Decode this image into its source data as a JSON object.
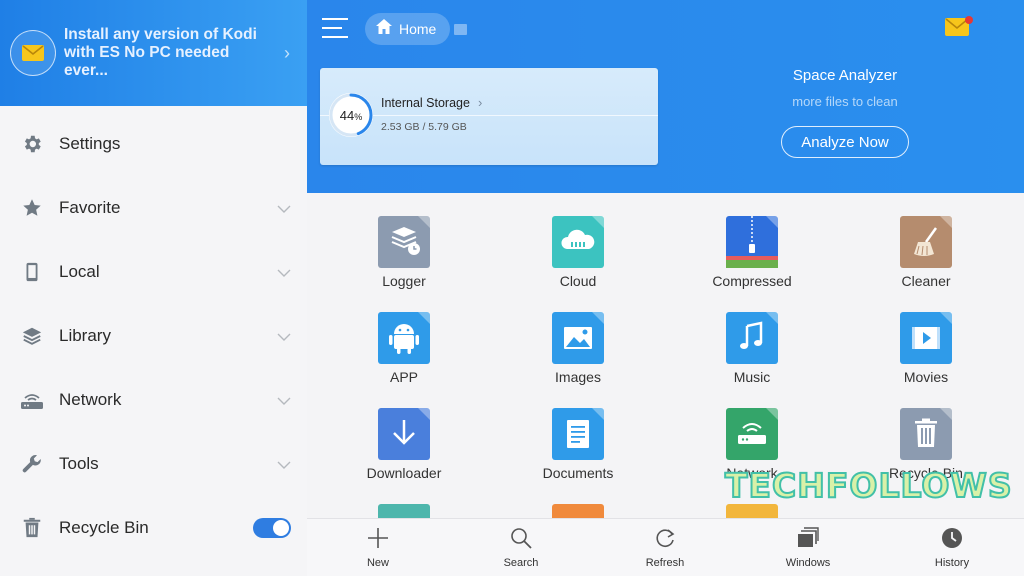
{
  "promo": {
    "text": "Install any version of Kodi with ES No PC needed ever...",
    "icon": "mail-icon"
  },
  "sidebar": {
    "items": [
      {
        "label": "Settings",
        "icon": "gear-icon",
        "expandable": false
      },
      {
        "label": "Favorite",
        "icon": "star-icon",
        "expandable": true
      },
      {
        "label": "Local",
        "icon": "phone-icon",
        "expandable": true
      },
      {
        "label": "Library",
        "icon": "layers-icon",
        "expandable": true
      },
      {
        "label": "Network",
        "icon": "router-icon",
        "expandable": true
      },
      {
        "label": "Tools",
        "icon": "wrench-icon",
        "expandable": true
      },
      {
        "label": "Recycle Bin",
        "icon": "trash-icon",
        "toggle": true
      }
    ]
  },
  "header": {
    "home_label": "Home"
  },
  "storage": {
    "percent": 44,
    "percent_number": "44",
    "percent_sign": "%",
    "title": "Internal Storage",
    "size": "2.53 GB / 5.79 GB"
  },
  "analyzer": {
    "title": "Space Analyzer",
    "subtitle": "more files to clean",
    "button": "Analyze Now"
  },
  "grid": {
    "tiles": [
      {
        "label": "Logger",
        "icon": "logger-icon",
        "color": "#8c9bb0"
      },
      {
        "label": "Cloud",
        "icon": "cloud-icon",
        "color": "#3cc3c0"
      },
      {
        "label": "Compressed",
        "icon": "zip-icon",
        "color": "#2f6fdc"
      },
      {
        "label": "Cleaner",
        "icon": "broom-icon",
        "color": "#b58c6e"
      },
      {
        "label": "APP",
        "icon": "android-icon",
        "color": "#2f9be9"
      },
      {
        "label": "Images",
        "icon": "image-icon",
        "color": "#2f9be9"
      },
      {
        "label": "Music",
        "icon": "music-icon",
        "color": "#2f9be9"
      },
      {
        "label": "Movies",
        "icon": "movie-icon",
        "color": "#2f9be9"
      },
      {
        "label": "Downloader",
        "icon": "download-icon",
        "color": "#4a7fdc"
      },
      {
        "label": "Documents",
        "icon": "document-icon",
        "color": "#2f9be9"
      },
      {
        "label": "Network",
        "icon": "router-icon",
        "color": "#34a56a"
      },
      {
        "label": "Recycle Bin",
        "icon": "trash-icon",
        "color": "#8c9bb0"
      }
    ]
  },
  "bottom_bar": {
    "items": [
      {
        "label": "New",
        "icon": "plus-icon"
      },
      {
        "label": "Search",
        "icon": "search-icon"
      },
      {
        "label": "Refresh",
        "icon": "refresh-icon"
      },
      {
        "label": "Windows",
        "icon": "windows-icon"
      },
      {
        "label": "History",
        "icon": "history-icon"
      }
    ]
  },
  "watermark": {
    "text": "TECHFOLLOWS"
  },
  "colors": {
    "accent": "#2a86eb",
    "toggle_on": "#2f7de1",
    "sidebar_bg": "#f5f5f7",
    "grid_bg": "#f4f4f6"
  }
}
